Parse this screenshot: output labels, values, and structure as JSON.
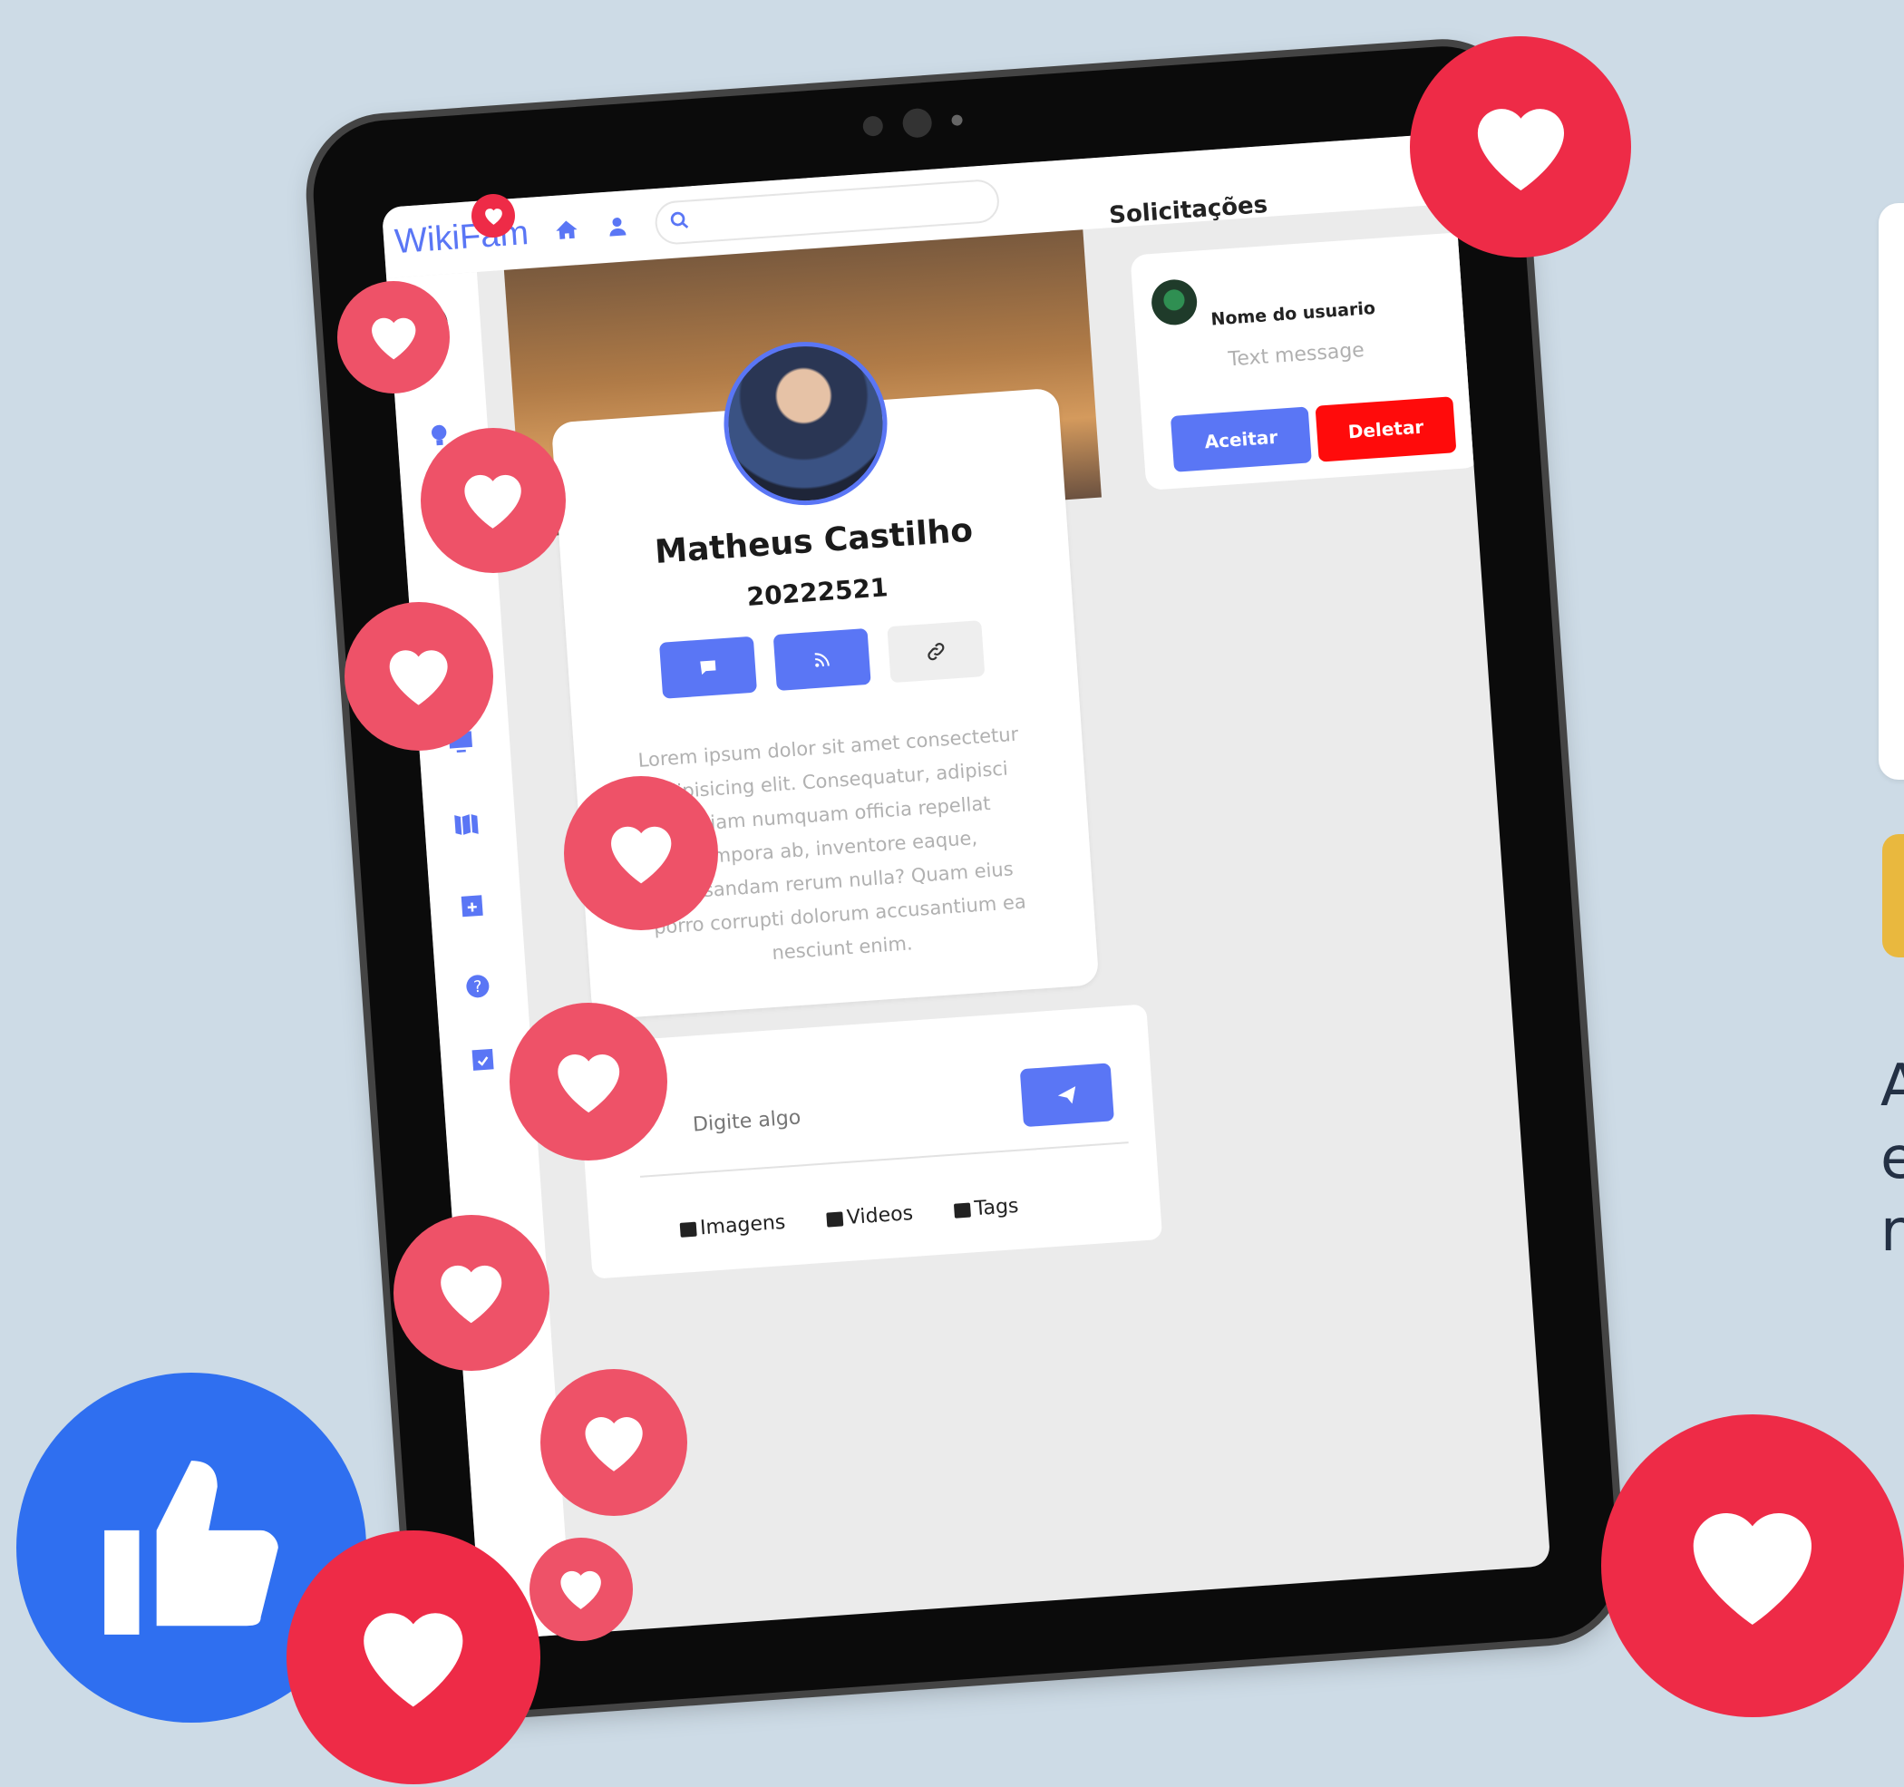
{
  "app": {
    "logo": "WikiFam",
    "search": {
      "placeholder": ""
    }
  },
  "profile": {
    "name": "Matheus Castilho",
    "code": "20222521",
    "bio": "Lorem ipsum dolor sit amet consectetur adipisicing elit. Consequatur, adipisci veniam numquam officia repellat tempora ab, inventore eaque, recusandam rerum nulla? Quam eius porro corrupti dolorum accusantium ea nesciunt enim.",
    "actions": [
      "message-icon",
      "rss-icon",
      "link-icon"
    ]
  },
  "post_box": {
    "placeholder": "Digite algo",
    "actions": [
      {
        "icon": "image-icon",
        "label": "Imagens"
      },
      {
        "icon": "video-icon",
        "label": "Videos"
      },
      {
        "icon": "tag-icon",
        "label": "Tags"
      }
    ]
  },
  "requests": {
    "title": "Solicitações",
    "items": [
      {
        "name": "Nome do usuario",
        "message": "Text message",
        "accept_label": "Aceitar",
        "delete_label": "Deletar"
      }
    ]
  },
  "sidebar": {
    "icons": [
      "avatar",
      "lightbulb-icon",
      "flag-icon",
      "bookmark-icon",
      "monitor-icon",
      "map-icon",
      "calendar-plus-icon",
      "help-icon",
      "calendar-check-icon"
    ]
  },
  "side_panel": {
    "text_lines": [
      "A",
      "e",
      "r"
    ]
  },
  "colors": {
    "accent": "#5a76f5",
    "danger": "#ff0b0b",
    "heart_red": "#ee2b47",
    "heart_pink": "#ee5268",
    "like_blue": "#2f6ff0",
    "background": "#cddbe6"
  }
}
